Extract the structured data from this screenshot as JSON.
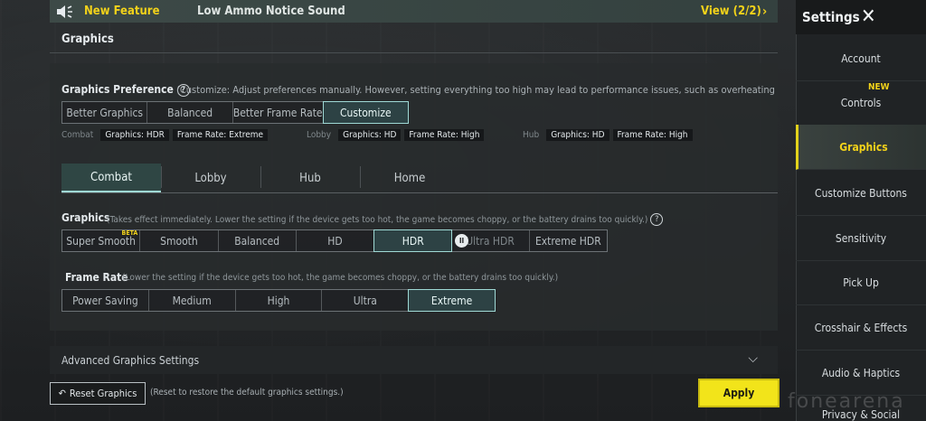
{
  "notice": {
    "tag": "New Feature",
    "message": "Low Ammo Notice Sound",
    "view": "View (2/2)"
  },
  "section": {
    "title": "Graphics"
  },
  "preference": {
    "label": "Graphics Preference",
    "description": "(Customize: Adjust preferences manually. However, setting everything too high may lead to performance issues, such as overheating, battery drain, o",
    "options": [
      "Better Graphics",
      "Balanced",
      "Better Frame Rate",
      "Customize"
    ],
    "selected": "Customize"
  },
  "summary": [
    {
      "label": "Combat",
      "graphics": "Graphics: HDR",
      "frame_rate": "Frame Rate: Extreme"
    },
    {
      "label": "Lobby",
      "graphics": "Graphics: HD",
      "frame_rate": "Frame Rate: High"
    },
    {
      "label": "Hub",
      "graphics": "Graphics: HD",
      "frame_rate": "Frame Rate: High"
    }
  ],
  "tabs": [
    "Combat",
    "Lobby",
    "Hub",
    "Home"
  ],
  "active_tab": "Combat",
  "graphics": {
    "label": "Graphics",
    "description": "(Takes effect immediately. Lower the setting if the device gets too hot, the game becomes choppy, or the battery drains too quickly.)",
    "options": [
      "Super Smooth",
      "Smooth",
      "Balanced",
      "HD",
      "HDR",
      "Ultra HDR",
      "Extreme HDR"
    ],
    "beta": "BETA",
    "selected": "HDR"
  },
  "frame_rate": {
    "label": "Frame Rate",
    "description": "(Lower the setting if the device gets too hot, the game becomes choppy, or the battery drains too quickly.)",
    "options": [
      "Power Saving",
      "Medium",
      "High",
      "Ultra",
      "Extreme"
    ],
    "selected": "Extreme"
  },
  "advanced": {
    "label": "Advanced Graphics Settings"
  },
  "footer": {
    "reset": "Reset Graphics",
    "reset_hint": "(Reset to restore the default graphics settings.)",
    "apply": "Apply"
  },
  "sidebar": {
    "title": "Settings",
    "new_badge": "NEW",
    "items": [
      "Account",
      "Controls",
      "Graphics",
      "Customize Buttons",
      "Sensitivity",
      "Pick Up",
      "Crosshair & Effects",
      "Audio & Haptics",
      "Privacy & Social"
    ],
    "active": "Graphics"
  },
  "watermark": "fonearena",
  "colors": {
    "accent_yellow": "#f2d21a",
    "selection_teal": "#9fd9d5",
    "apply_button": "#f2e41a"
  }
}
